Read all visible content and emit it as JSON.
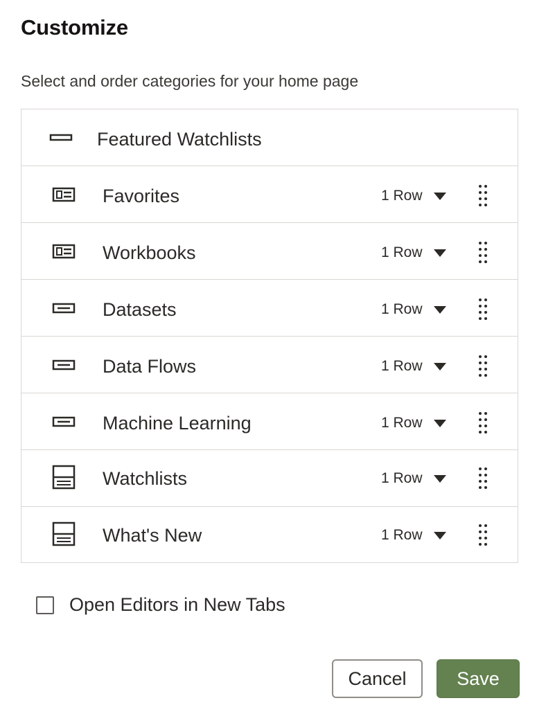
{
  "dialog": {
    "title": "Customize",
    "subtitle": "Select and order categories for your home page"
  },
  "featured": {
    "label": "Featured Watchlists",
    "icon": "banner-icon"
  },
  "categories": [
    {
      "label": "Favorites",
      "rows": "1 Row",
      "icon": "card-list-icon"
    },
    {
      "label": "Workbooks",
      "rows": "1 Row",
      "icon": "card-list-icon"
    },
    {
      "label": "Datasets",
      "rows": "1 Row",
      "icon": "tile-icon"
    },
    {
      "label": "Data Flows",
      "rows": "1 Row",
      "icon": "tile-icon"
    },
    {
      "label": "Machine Learning",
      "rows": "1 Row",
      "icon": "tile-icon"
    },
    {
      "label": "Watchlists",
      "rows": "1 Row",
      "icon": "panel-icon"
    },
    {
      "label": "What's New",
      "rows": "1 Row",
      "icon": "panel-icon"
    }
  ],
  "open_editors": {
    "label": "Open Editors in New Tabs",
    "checked": false
  },
  "buttons": {
    "cancel": "Cancel",
    "save": "Save"
  },
  "colors": {
    "save_button": "#648150",
    "border": "#d9d7d3",
    "text": "#2b2a27"
  }
}
